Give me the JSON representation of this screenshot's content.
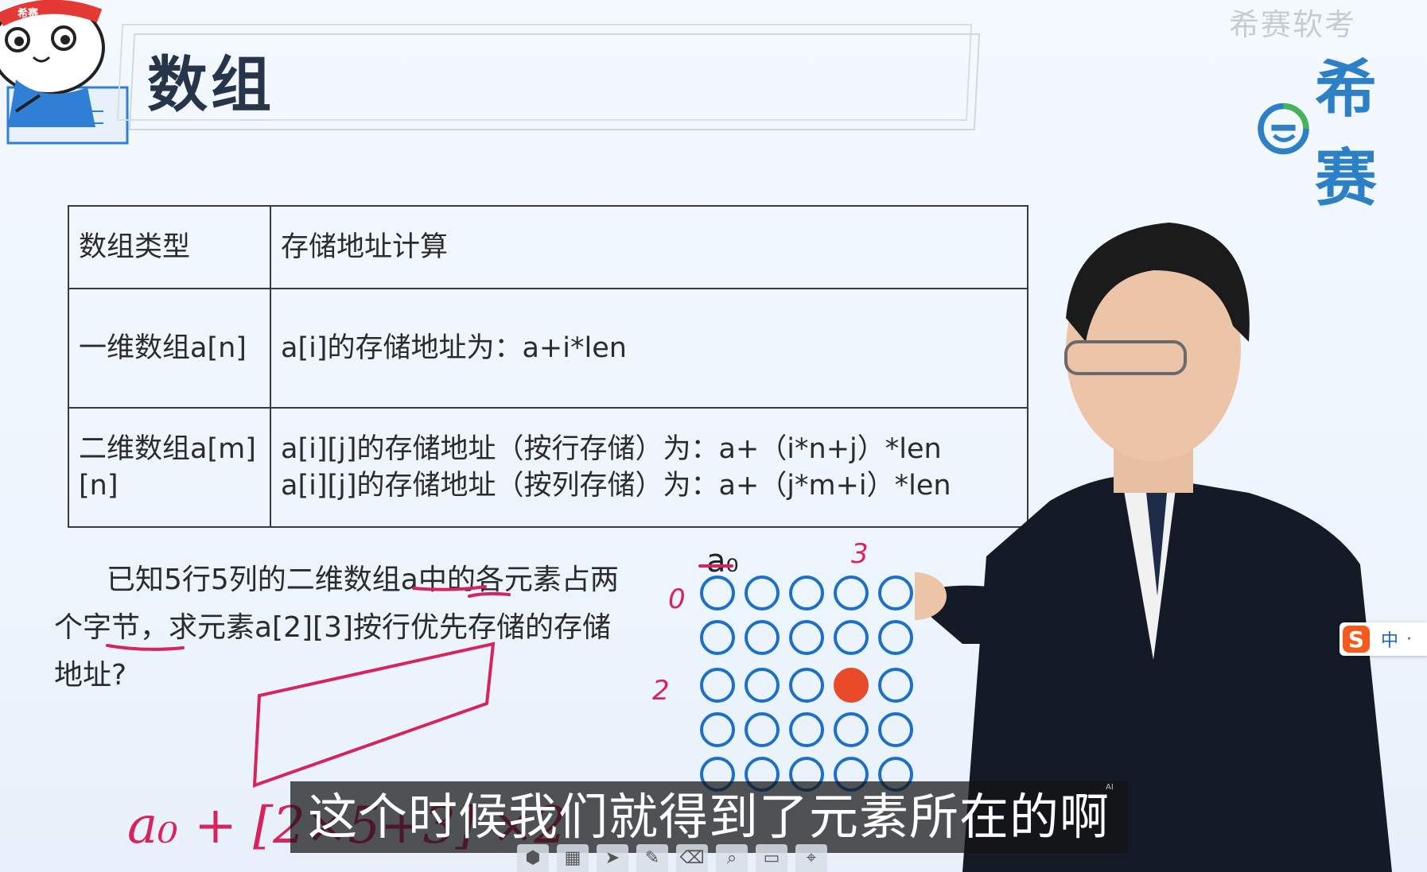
{
  "header": {
    "title": "数组",
    "watermark": "希赛软考",
    "brand_text": "希赛",
    "mascot_badge": "希赛"
  },
  "table": {
    "headers": [
      "数组类型",
      "存储地址计算"
    ],
    "rows": [
      {
        "type": "一维数组a[n]",
        "calc": [
          "a[i]的存储地址为：a+i*len"
        ]
      },
      {
        "type": "二维数组a[m][n]",
        "calc": [
          "a[i][j]的存储地址（按行存储）为：a+（i*n+j）*len",
          "a[i][j]的存储地址（按列存储）为：a+（j*m+i）*len"
        ]
      }
    ]
  },
  "question": "已知5行5列的二维数组a中的各元素占两个字节，求元素a[2][3]按行优先存储的存储地址?",
  "grid": {
    "label": "a₀",
    "rows": 5,
    "cols": 5,
    "highlight": {
      "row": 2,
      "col": 3
    },
    "row_marks": [
      "0",
      "2"
    ],
    "col_mark": "3"
  },
  "handwriting": {
    "formula": "a₀ + [2×5+3] ×2"
  },
  "subtitle": "这个时候我们就得到了元素所在的啊",
  "subtitle_tag": "AI",
  "ime": {
    "brand": "S",
    "mode": "中"
  },
  "toolbar": [
    "3d-box-icon",
    "grid-icon",
    "pointer-icon",
    "pen-icon",
    "eraser-icon",
    "zoom-icon",
    "screen-icon",
    "pin-icon"
  ],
  "colors": {
    "circle": "#1d6fc7",
    "highlight": "#e84a2a",
    "ink": "#d6245c",
    "brand": "#2d7fc6",
    "title": "#27354a"
  }
}
